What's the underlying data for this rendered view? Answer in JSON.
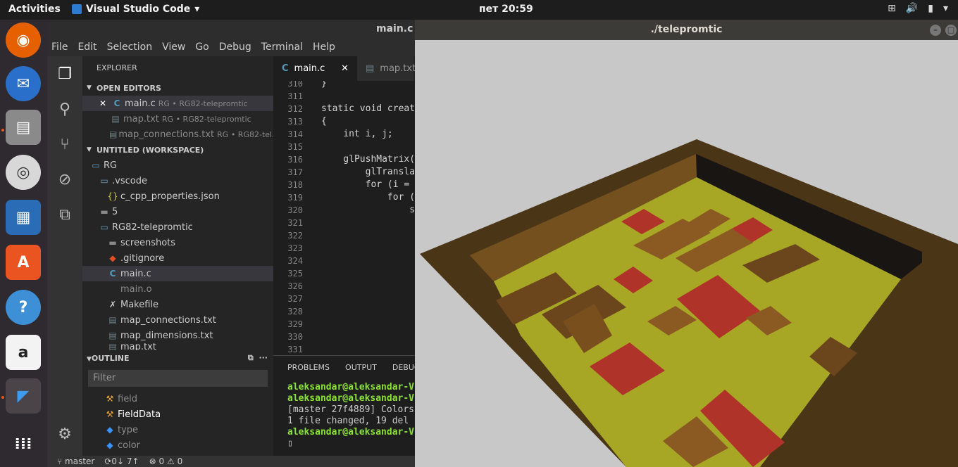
{
  "topbar": {
    "activities": "Activities",
    "app_name": "Visual Studio Code",
    "clock": "пет 20:59"
  },
  "vscode": {
    "title": "main.c -",
    "menu": [
      "File",
      "Edit",
      "Selection",
      "View",
      "Go",
      "Debug",
      "Terminal",
      "Help"
    ],
    "explorer_label": "EXPLORER",
    "open_editors_label": "OPEN EDITORS",
    "open_editors": [
      {
        "name": "main.c",
        "desc": "RG • RG82-telepromtic"
      },
      {
        "name": "map.txt",
        "desc": "RG • RG82-telepromtic"
      },
      {
        "name": "map_connections.txt",
        "desc": "RG • RG82-tel..."
      }
    ],
    "workspace_label": "UNTITLED (WORKSPACE)",
    "tree": [
      {
        "name": "RG"
      },
      {
        "name": ".vscode"
      },
      {
        "name": "c_cpp_properties.json"
      },
      {
        "name": "5"
      },
      {
        "name": "RG82-telepromtic"
      },
      {
        "name": "screenshots"
      },
      {
        "name": ".gitignore"
      },
      {
        "name": "main.c"
      },
      {
        "name": "main.o"
      },
      {
        "name": "Makefile"
      },
      {
        "name": "map_connections.txt"
      },
      {
        "name": "map_dimensions.txt"
      },
      {
        "name": "map.txt"
      }
    ],
    "outline_label": "OUTLINE",
    "filter_placeholder": "Filter",
    "outline": [
      "field",
      "FieldData",
      "type",
      "color"
    ],
    "tabs": [
      {
        "label": "main.c"
      },
      {
        "label": "map.txt"
      }
    ],
    "line_numbers": [
      "310",
      "311",
      "312",
      "313",
      "314",
      "315",
      "316",
      "317",
      "318",
      "319",
      "320",
      "321",
      "322",
      "323",
      "324",
      "325",
      "326",
      "327",
      "328",
      "329",
      "330",
      "331"
    ],
    "code_lines": [
      "}",
      "",
      "static void creat",
      "{",
      "    int i, j;",
      "",
      "    glPushMatrix(",
      "        glTransla",
      "        for (i =",
      "            for (",
      "                s",
      "",
      "",
      "",
      "",
      "",
      "",
      "",
      "",
      "",
      "",
      ""
    ],
    "panel_tabs": [
      "PROBLEMS",
      "OUTPUT",
      "DEBUG C"
    ],
    "terminal": [
      {
        "prompt": "aleksandar@aleksandar-V",
        "text": ""
      },
      {
        "prompt": "aleksandar@aleksandar-V",
        "text": ""
      },
      {
        "prompt": "",
        "text": "[master 27f4889] Colors"
      },
      {
        "prompt": "",
        "text": " 1 file changed, 19 del"
      },
      {
        "prompt": "aleksandar@aleksandar-V",
        "text": ""
      }
    ],
    "status": {
      "branch": "master",
      "sync": "0↓ 7↑",
      "errors": "0",
      "warnings": "0"
    }
  },
  "glwindow": {
    "title": "./telepromtic"
  }
}
